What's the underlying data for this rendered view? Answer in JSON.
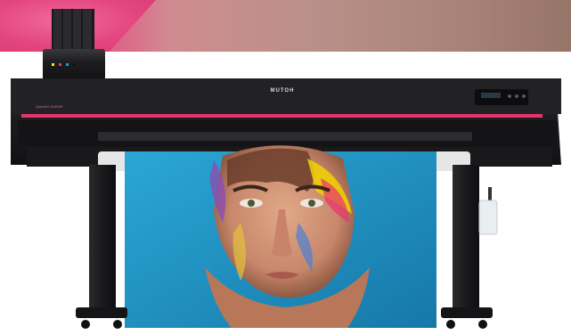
{
  "image": {
    "subject": "large-format-printer",
    "brand_label": "MUTOH",
    "model_label": "XpertJet 1641SR",
    "colors": {
      "accent_stripe": "#e8336f",
      "printer_body": "#1c1c1e",
      "print_background": "#1f8fbf"
    }
  }
}
